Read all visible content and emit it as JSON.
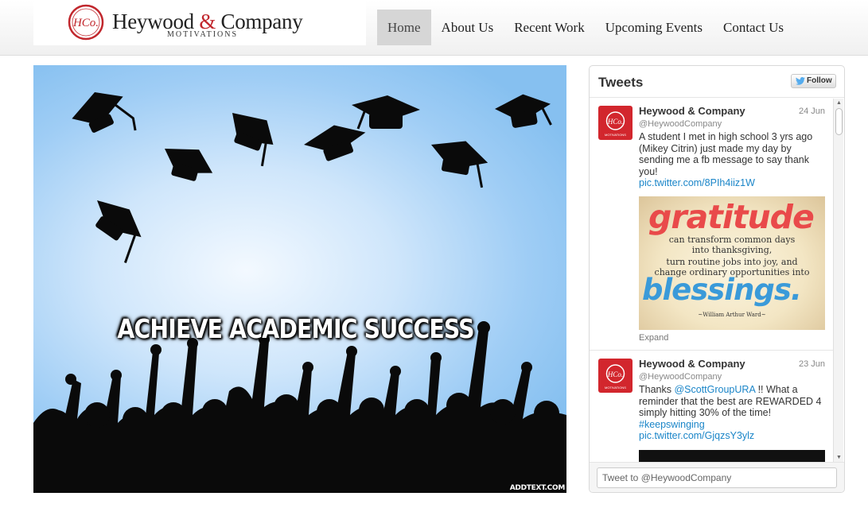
{
  "brand": {
    "seal_text": "HCo.",
    "name_part1": "Heywood",
    "ampersand": "&",
    "name_part2": "Company",
    "subtitle": "MOTIVATIONS",
    "accent_color": "#c1272d"
  },
  "nav": {
    "items": [
      {
        "label": "Home",
        "active": true
      },
      {
        "label": "About Us",
        "active": false
      },
      {
        "label": "Recent Work",
        "active": false
      },
      {
        "label": "Upcoming Events",
        "active": false
      },
      {
        "label": "Contact Us",
        "active": false
      }
    ]
  },
  "hero": {
    "headline": "ACHIEVE ACADEMIC SUCCESS",
    "credit": "ADDTEXT.COM"
  },
  "tweets": {
    "title": "Tweets",
    "follow_label": "Follow",
    "compose_placeholder": "Tweet to @HeywoodCompany",
    "items": [
      {
        "name": "Heywood & Company",
        "handle": "@HeywoodCompany",
        "date": "24 Jun",
        "text": "A student I met in high school 3 yrs ago (Mikey Citrin) just made my day by sending me a fb message to say thank you!",
        "link": "pic.twitter.com/8PIh4iiz1W",
        "expand_label": "Expand",
        "image": {
          "title": "gratitude",
          "lines": [
            "can transform common days",
            "into thanksgiving,",
            "turn routine jobs into joy, and",
            "change ordinary opportunities into"
          ],
          "closing": "blessings.",
          "author": "~William Arthur Ward~"
        }
      },
      {
        "name": "Heywood & Company",
        "handle": "@HeywoodCompany",
        "date": "23 Jun",
        "text_before": "Thanks ",
        "mention": "@ScottGroupURA",
        "text_after": " !! What a reminder that the best  are REWARDED 4 simply hitting 30% of the time! ",
        "hashtag": "#keepswinging",
        "link": "pic.twitter.com/GjqzsY3ylz"
      }
    ]
  },
  "colors": {
    "link": "#1a85c8",
    "avatar_red": "#d2262d",
    "nav_active_bg": "#d6d6d6"
  },
  "icons": [
    "logo-seal-icon",
    "twitter-bird-icon",
    "scroll-up-arrow-icon",
    "scroll-down-arrow-icon"
  ]
}
